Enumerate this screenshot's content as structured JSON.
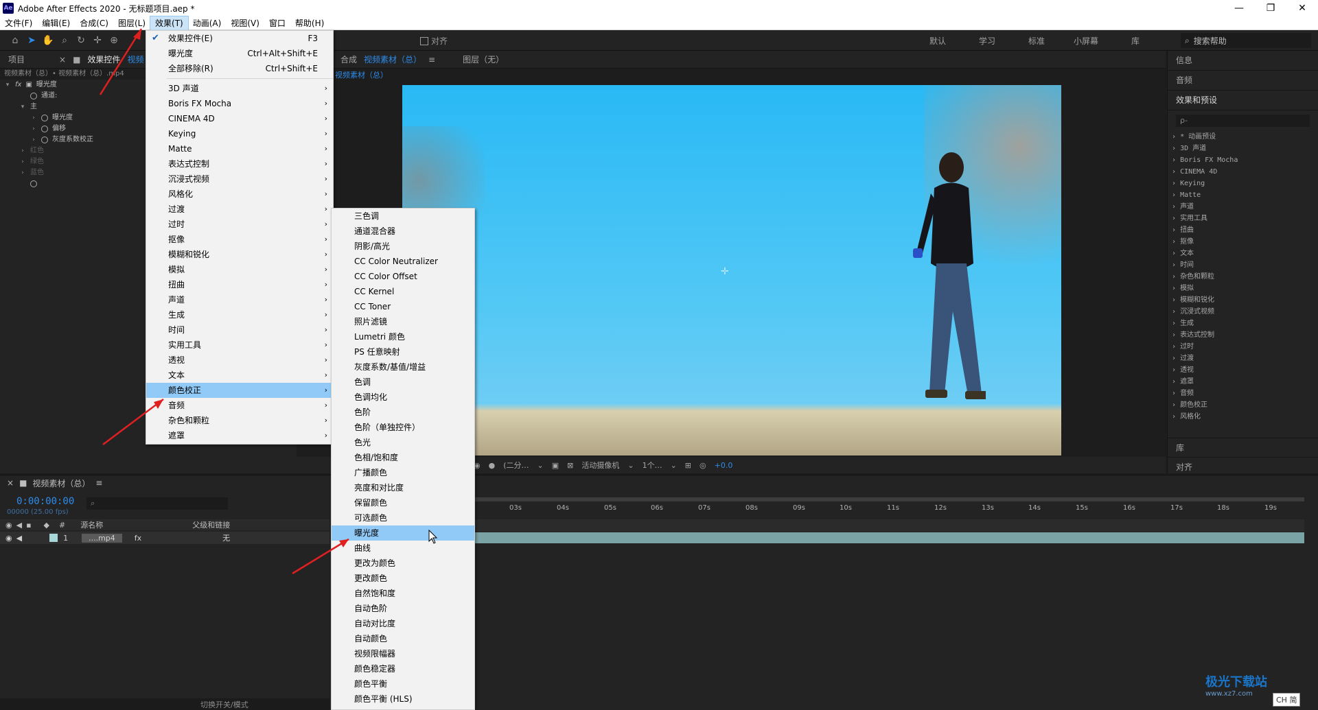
{
  "window": {
    "title": "Adobe After Effects 2020 - 无标题项目.aep *",
    "app_icon": "Ae"
  },
  "menubar": [
    "文件(F)",
    "编辑(E)",
    "合成(C)",
    "图层(L)",
    "效果(T)",
    "动画(A)",
    "视图(V)",
    "窗口",
    "帮助(H)"
  ],
  "toolbar": {
    "snap_label": "对齐",
    "workspaces": [
      "默认",
      "学习",
      "标准",
      "小屏幕",
      "库"
    ],
    "help_search": "搜索帮助"
  },
  "left_panel": {
    "tab_project": "项目",
    "tab_effects": "效果控件",
    "tab_suffix": "视频",
    "sub_header": "视频素材（总）• 视频素材（总）.mp4",
    "effect_name": "曝光度",
    "rows": [
      "通道:",
      "主",
      "曝光度",
      "偏移",
      "灰度系数校正",
      "红色",
      "绿色",
      "蓝色"
    ]
  },
  "comp_panel": {
    "tab_comp_prefix": "合成",
    "tab_comp_name": "视频素材（总）",
    "tab_layer": "图层（无）",
    "sub_tab": "视频素材（总）",
    "zoom": "(二分…",
    "camera": "活动摄像机",
    "views": "1个…",
    "exposure": "+0.0"
  },
  "right_panel": {
    "info": "信息",
    "audio": "音频",
    "effects_presets": "效果和预设",
    "search_placeholder": "ρ-",
    "items": [
      "* 动画预设",
      "3D 声道",
      "Boris FX Mocha",
      "CINEMA 4D",
      "Keying",
      "Matte",
      "声道",
      "实用工具",
      "扭曲",
      "抠像",
      "文本",
      "时间",
      "杂色和颗粒",
      "模拟",
      "模糊和锐化",
      "沉浸式视频",
      "生成",
      "表达式控制",
      "过时",
      "过渡",
      "透视",
      "遮罩",
      "音频",
      "颜色校正",
      "风格化"
    ],
    "library": "库",
    "align": "对齐"
  },
  "timeline": {
    "title": "视频素材（总）",
    "timecode": "0:00:00:00",
    "fps": "00000 (25.00 fps)",
    "col_source": "源名称",
    "col_parent": "父级和链接",
    "layer_index": "1",
    "layer_name": "....mp4",
    "layer_parent": "无",
    "ruler_ticks": [
      "03s",
      "04s",
      "05s",
      "06s",
      "07s",
      "08s",
      "09s",
      "10s",
      "11s",
      "12s",
      "13s",
      "14s",
      "15s",
      "16s",
      "17s",
      "18s",
      "19s"
    ],
    "bottom_toggle": "切换开关/模式"
  },
  "effects_menu": {
    "top_items": [
      {
        "label": "效果控件(E)",
        "shortcut": "F3",
        "checked": true
      },
      {
        "label": "曝光度",
        "shortcut": "Ctrl+Alt+Shift+E"
      },
      {
        "label": "全部移除(R)",
        "shortcut": "Ctrl+Shift+E"
      }
    ],
    "categories": [
      "3D 声道",
      "Boris FX Mocha",
      "CINEMA 4D",
      "Keying",
      "Matte",
      "表达式控制",
      "沉浸式视频",
      "风格化",
      "过渡",
      "过时",
      "抠像",
      "模糊和锐化",
      "模拟",
      "扭曲",
      "声道",
      "生成",
      "时间",
      "实用工具",
      "透视",
      "文本",
      "颜色校正",
      "音频",
      "杂色和颗粒",
      "遮罩"
    ],
    "highlighted": "颜色校正"
  },
  "color_menu": {
    "items": [
      "三色调",
      "通道混合器",
      "阴影/高光",
      "CC Color Neutralizer",
      "CC Color Offset",
      "CC Kernel",
      "CC Toner",
      "照片滤镜",
      "Lumetri 颜色",
      "PS 任意映射",
      "灰度系数/基值/增益",
      "色调",
      "色调均化",
      "色阶",
      "色阶（单独控件）",
      "色光",
      "色相/饱和度",
      "广播颜色",
      "亮度和对比度",
      "保留颜色",
      "可选颜色",
      "曝光度",
      "曲线",
      "更改为颜色",
      "更改颜色",
      "自然饱和度",
      "自动色阶",
      "自动对比度",
      "自动颜色",
      "视频限幅器",
      "颜色稳定器",
      "颜色平衡",
      "颜色平衡 (HLS)"
    ],
    "highlighted": "曝光度"
  },
  "watermark": {
    "text": "极光下载站",
    "sub": "www.xz7.com"
  },
  "ime": "CH 简",
  "colors": {
    "accent": "#2d8ceb",
    "menu_highlight": "#91c9f7",
    "arrow": "#e02020"
  }
}
